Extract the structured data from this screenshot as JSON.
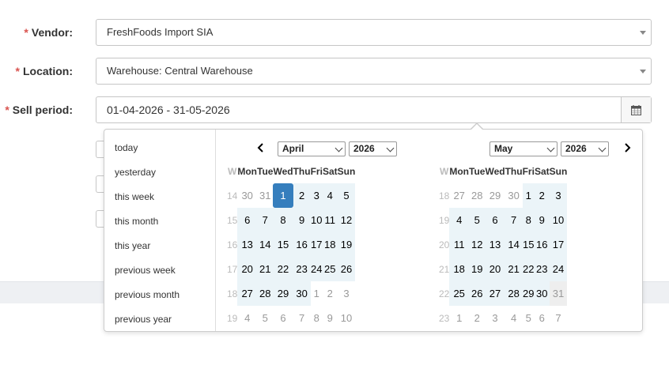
{
  "form": {
    "required_mark": "*",
    "vendor": {
      "label": "Vendor:",
      "value": "FreshFoods Import SIA"
    },
    "location": {
      "label": "Location:",
      "value": "Warehouse: Central Warehouse"
    },
    "sell_period": {
      "label": "Sell period:",
      "value": "01-04-2026 - 31-05-2026",
      "icon": "calendar-icon"
    }
  },
  "picker": {
    "ranges": [
      "today",
      "yesterday",
      "this week",
      "this month",
      "this year",
      "previous week",
      "previous month",
      "previous year"
    ],
    "weekday_headers": [
      "W",
      "Mon",
      "Tue",
      "Wed",
      "Thu",
      "Fri",
      "Sat",
      "Sun"
    ],
    "left": {
      "month": "April",
      "year": "2026",
      "weeks": [
        {
          "wk": "14",
          "days": [
            "30",
            "31",
            "1",
            "2",
            "3",
            "4",
            "5"
          ]
        },
        {
          "wk": "15",
          "days": [
            "6",
            "7",
            "8",
            "9",
            "10",
            "11",
            "12"
          ]
        },
        {
          "wk": "16",
          "days": [
            "13",
            "14",
            "15",
            "16",
            "17",
            "18",
            "19"
          ]
        },
        {
          "wk": "17",
          "days": [
            "20",
            "21",
            "22",
            "23",
            "24",
            "25",
            "26"
          ]
        },
        {
          "wk": "18",
          "days": [
            "27",
            "28",
            "29",
            "30",
            "1",
            "2",
            "3"
          ]
        },
        {
          "wk": "19",
          "days": [
            "4",
            "5",
            "6",
            "7",
            "8",
            "9",
            "10"
          ]
        }
      ]
    },
    "right": {
      "month": "May",
      "year": "2026",
      "weeks": [
        {
          "wk": "18",
          "days": [
            "27",
            "28",
            "29",
            "30",
            "1",
            "2",
            "3"
          ]
        },
        {
          "wk": "19",
          "days": [
            "4",
            "5",
            "6",
            "7",
            "8",
            "9",
            "10"
          ]
        },
        {
          "wk": "20",
          "days": [
            "11",
            "12",
            "13",
            "14",
            "15",
            "16",
            "17"
          ]
        },
        {
          "wk": "21",
          "days": [
            "18",
            "19",
            "20",
            "21",
            "22",
            "23",
            "24"
          ]
        },
        {
          "wk": "22",
          "days": [
            "25",
            "26",
            "27",
            "28",
            "29",
            "30",
            "31"
          ]
        },
        {
          "wk": "23",
          "days": [
            "1",
            "2",
            "3",
            "4",
            "5",
            "6",
            "7"
          ]
        }
      ]
    },
    "colors": {
      "active": "#357ebd",
      "in_range": "#ebf4f8",
      "required": "#d9534f"
    }
  }
}
